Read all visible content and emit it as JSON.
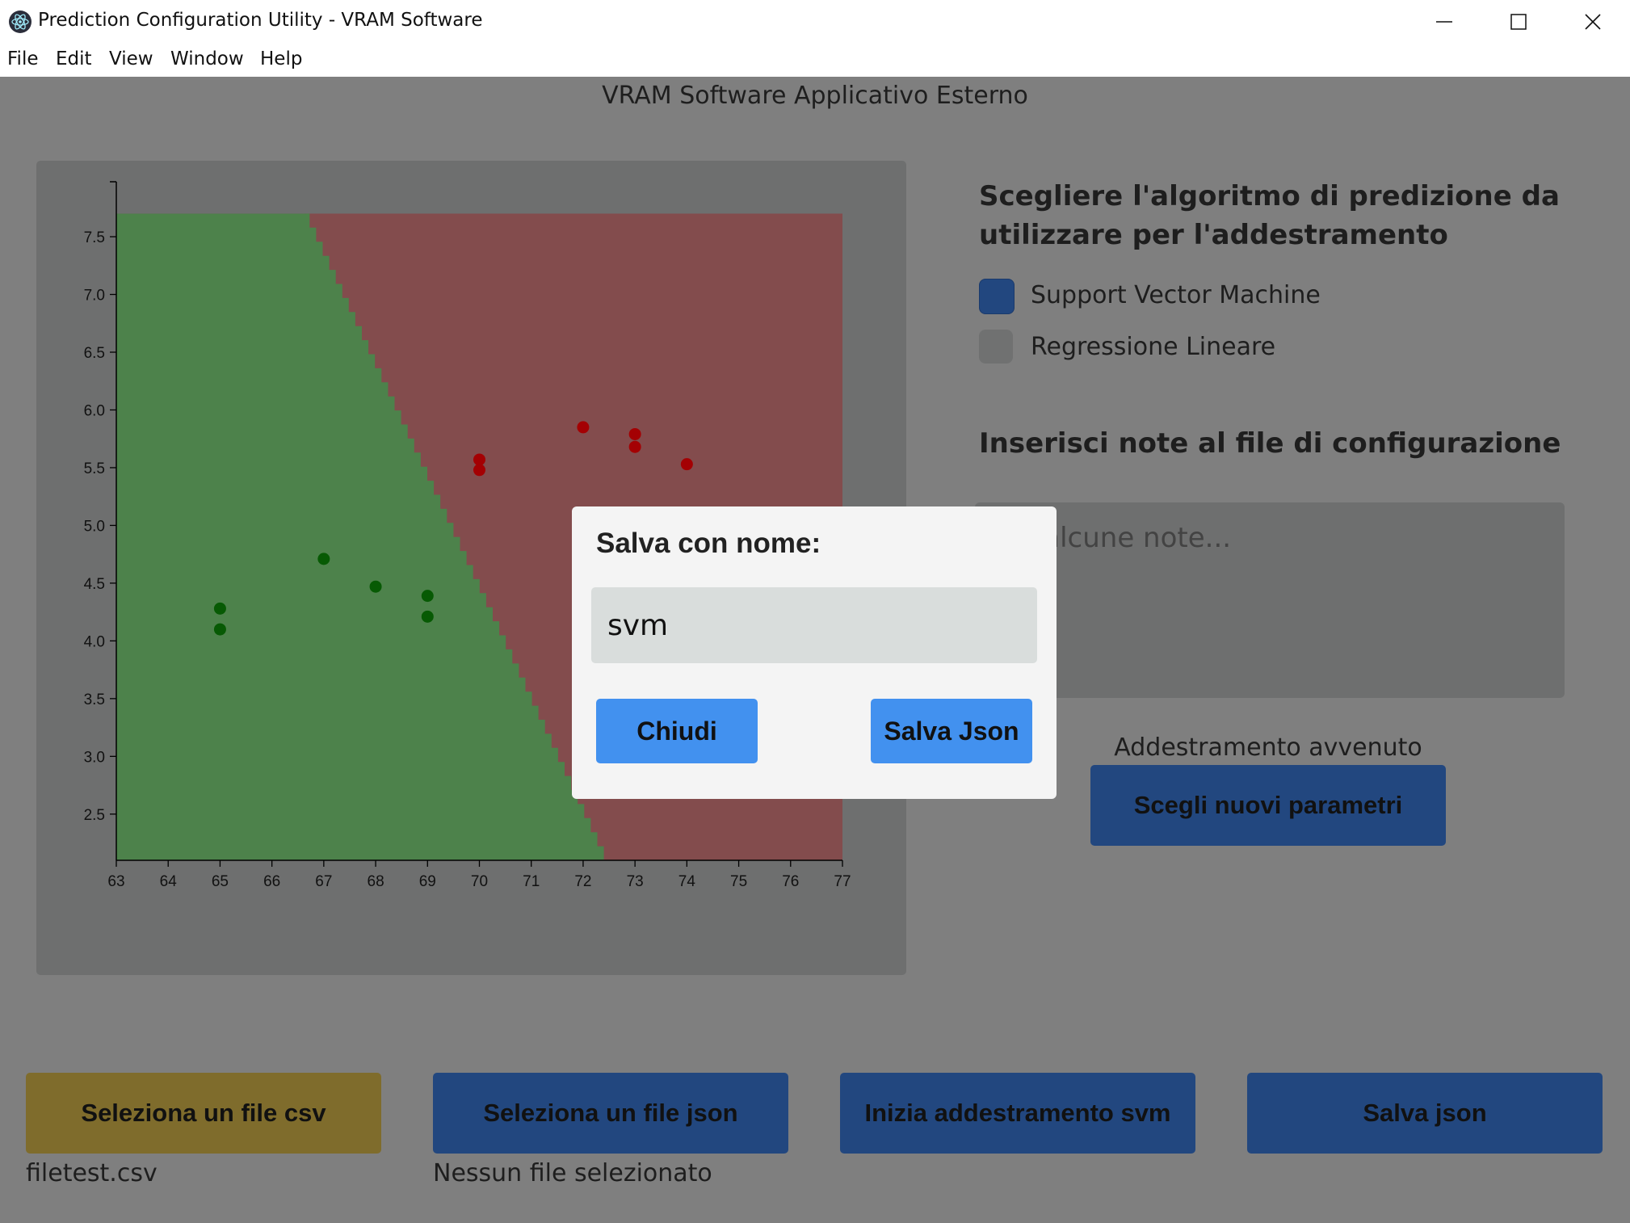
{
  "window": {
    "title": "Prediction Configuration Utility - VRAM Software",
    "menu": [
      "File",
      "Edit",
      "View",
      "Window",
      "Help"
    ]
  },
  "app": {
    "header": "VRAM Software Applicativo Esterno"
  },
  "algorithm": {
    "title_line1": "Scegliere l'algoritmo di predizione da",
    "title_line2": "utilizzare per l'addestramento",
    "options": [
      {
        "label": "Support Vector Machine",
        "checked": true
      },
      {
        "label": "Regressione Lineare",
        "checked": false
      }
    ]
  },
  "notes": {
    "title": "Inserisci note al file di configurazione",
    "placeholder_visible": "i alcune note..."
  },
  "training": {
    "status": "Addestramento avvenuto",
    "new_params_label": "Scegli nuovi parametri"
  },
  "bottom": {
    "csv_button": "Seleziona un file csv",
    "json_button": "Seleziona un file json",
    "train_button": "Inizia addestramento svm",
    "save_button": "Salva json",
    "csv_file": "filetest.csv",
    "json_file": "Nessun file selezionato"
  },
  "dialog": {
    "title": "Salva con nome:",
    "input_value": "svm",
    "close_label": "Chiudi",
    "save_label": "Salva Json"
  },
  "colors": {
    "accent_blue": "#22477f",
    "csv_yellow": "#7f6c2c",
    "green_region": "#4d824b",
    "red_region": "#834c4d",
    "dialog_button": "#4291ef"
  },
  "chart_data": {
    "type": "scatter",
    "xlim": [
      63,
      77
    ],
    "ylim": [
      2.1,
      7.85
    ],
    "x_ticks": [
      63,
      64,
      65,
      66,
      67,
      68,
      69,
      70,
      71,
      72,
      73,
      74,
      75,
      76,
      77
    ],
    "y_ticks": [
      2.5,
      3.0,
      3.5,
      4.0,
      4.5,
      5.0,
      5.5,
      6.0,
      6.5,
      7.0,
      7.5
    ],
    "region_top": 7.7,
    "region_right": 77,
    "boundary": [
      [
        66.6,
        7.7
      ],
      [
        72.4,
        2.1
      ]
    ],
    "series": [
      {
        "class": "green",
        "color": "#075a04",
        "points": [
          [
            65,
            4.28
          ],
          [
            65,
            4.1
          ],
          [
            67,
            4.71
          ],
          [
            68,
            4.47
          ],
          [
            69,
            4.39
          ],
          [
            69,
            4.21
          ]
        ]
      },
      {
        "class": "red",
        "color": "#a40003",
        "points": [
          [
            70,
            5.57
          ],
          [
            70,
            5.48
          ],
          [
            72,
            5.85
          ],
          [
            73,
            5.79
          ],
          [
            73,
            5.68
          ],
          [
            74,
            5.53
          ]
        ]
      }
    ]
  }
}
